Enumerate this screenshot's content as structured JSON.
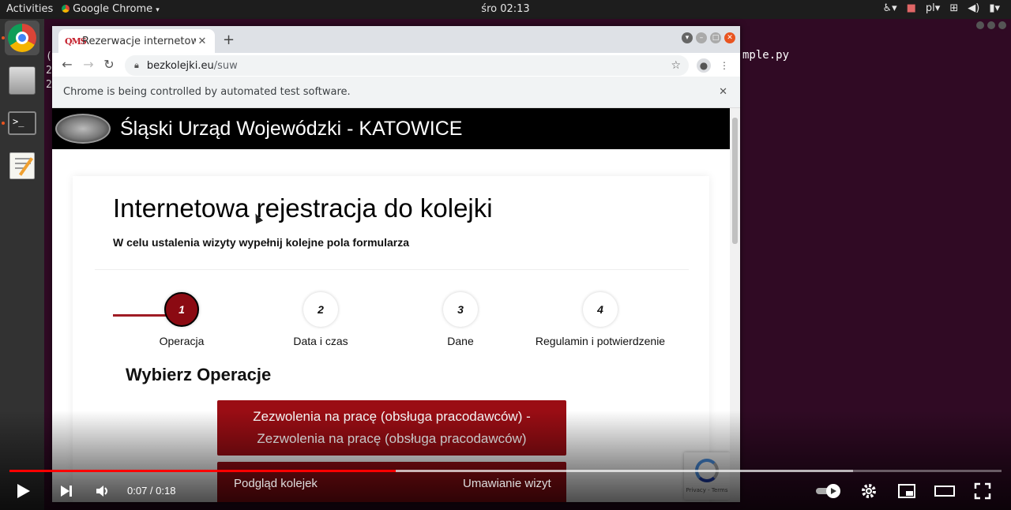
{
  "topbar": {
    "activities": "Activities",
    "app_name": "Google Chrome",
    "clock": "śro 02:13",
    "lang": "pl"
  },
  "terminal": {
    "title_fragment": "…",
    "visible_line": "mple.py",
    "left_fragments": [
      "(",
      "2",
      "2"
    ]
  },
  "browser": {
    "tab_title": "Rezerwacje internetowe",
    "tab_favicon_text": "QMS",
    "url_host": "bezkolejki.eu",
    "url_path": "/suw",
    "infobar_text": "Chrome is being controlled by automated test software."
  },
  "site": {
    "header_title": "Śląski Urząd Wojewódzki - KATOWICE",
    "heading": "Internetowa rejestracja do kolejki",
    "subheading": "W celu ustalenia wizyty wypełnij kolejne pola formularza",
    "steps": [
      {
        "num": "1",
        "label": "Operacja"
      },
      {
        "num": "2",
        "label": "Data i czas"
      },
      {
        "num": "3",
        "label": "Dane"
      },
      {
        "num": "4",
        "label": "Regulamin i potwierdzenie"
      }
    ],
    "active_step": 1,
    "operations_heading": "Wybierz Operacje",
    "operations": [
      {
        "line1": "Zezwolenia na pracę (obsługa pracodawców) -",
        "line2": "Zezwolenia na pracę (obsługa pracodawców)"
      },
      {
        "line1": "",
        "line2": ""
      }
    ],
    "recaptcha_terms": "Privacy - Terms"
  },
  "video": {
    "current_time": "0:07",
    "duration": "0:18",
    "progress_fraction": 0.389,
    "buffered_fraction": 0.85,
    "chapters": [
      "Podgląd kolejek",
      "Umawianie wizyt"
    ]
  },
  "colors": {
    "brand_red": "#9a0d14",
    "ubuntu_orange": "#e95420",
    "yt_red": "#ff0000"
  }
}
